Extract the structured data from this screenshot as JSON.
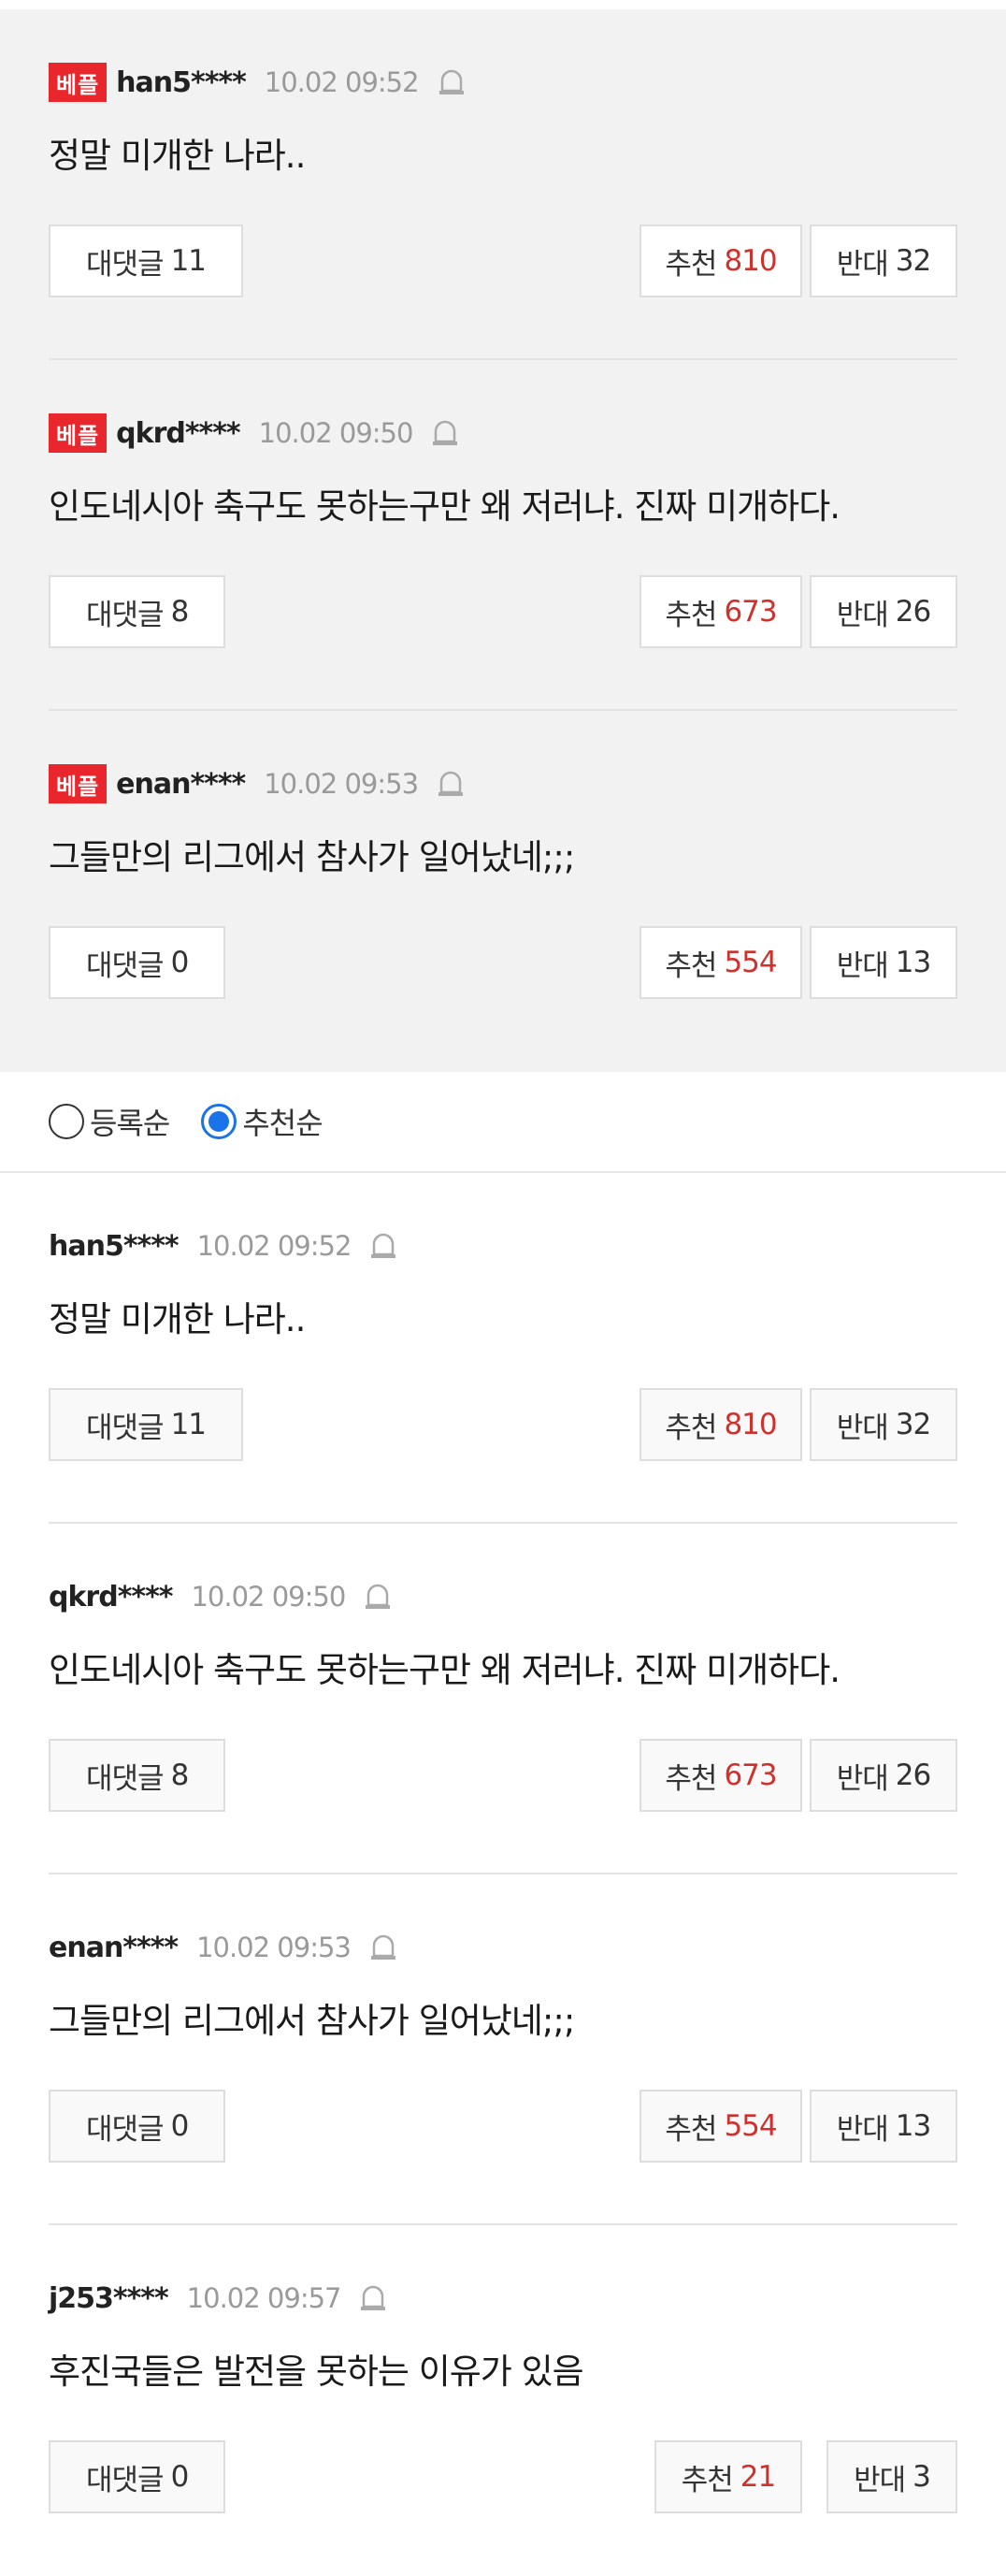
{
  "best_comments": [
    {
      "badge": "베플",
      "user": "han5****",
      "time": "10.02 09:52",
      "text": "정말 미개한 나라..",
      "reply_label": "대댓글",
      "reply_count": "11",
      "up_label": "추천",
      "up_count": "810",
      "down_label": "반대",
      "down_count": "32"
    },
    {
      "badge": "베플",
      "user": "qkrd****",
      "time": "10.02 09:50",
      "text": "인도네시아 축구도 못하는구만 왜 저러냐. 진짜 미개하다.",
      "reply_label": "대댓글",
      "reply_count": "8",
      "up_label": "추천",
      "up_count": "673",
      "down_label": "반대",
      "down_count": "26"
    },
    {
      "badge": "베플",
      "user": "enan****",
      "time": "10.02 09:53",
      "text": "그들만의 리그에서 참사가 일어났네;;;",
      "reply_label": "대댓글",
      "reply_count": "0",
      "up_label": "추천",
      "up_count": "554",
      "down_label": "반대",
      "down_count": "13"
    }
  ],
  "sort": {
    "options": [
      {
        "label": "등록순",
        "selected": false
      },
      {
        "label": "추천순",
        "selected": true
      }
    ]
  },
  "comments": [
    {
      "user": "han5****",
      "time": "10.02 09:52",
      "text": "정말 미개한 나라..",
      "reply_label": "대댓글",
      "reply_count": "11",
      "up_label": "추천",
      "up_count": "810",
      "down_label": "반대",
      "down_count": "32"
    },
    {
      "user": "qkrd****",
      "time": "10.02 09:50",
      "text": "인도네시아 축구도 못하는구만 왜 저러냐. 진짜 미개하다.",
      "reply_label": "대댓글",
      "reply_count": "8",
      "up_label": "추천",
      "up_count": "673",
      "down_label": "반대",
      "down_count": "26"
    },
    {
      "user": "enan****",
      "time": "10.02 09:53",
      "text": "그들만의 리그에서 참사가 일어났네;;;",
      "reply_label": "대댓글",
      "reply_count": "0",
      "up_label": "추천",
      "up_count": "554",
      "down_label": "반대",
      "down_count": "13"
    },
    {
      "user": "j253****",
      "time": "10.02 09:57",
      "text": "후진국들은 발전을 못하는 이유가 있음",
      "reply_label": "대댓글",
      "reply_count": "0",
      "up_label": "추천",
      "up_count": "21",
      "down_label": "반대",
      "down_count": "3"
    }
  ],
  "colors": {
    "badge": "#e8262b",
    "up_count": "#d0312d",
    "radio_selected": "#1a73e8",
    "best_background": "#f2f2f2"
  },
  "icons": {
    "report": "alarm-bell-icon"
  }
}
